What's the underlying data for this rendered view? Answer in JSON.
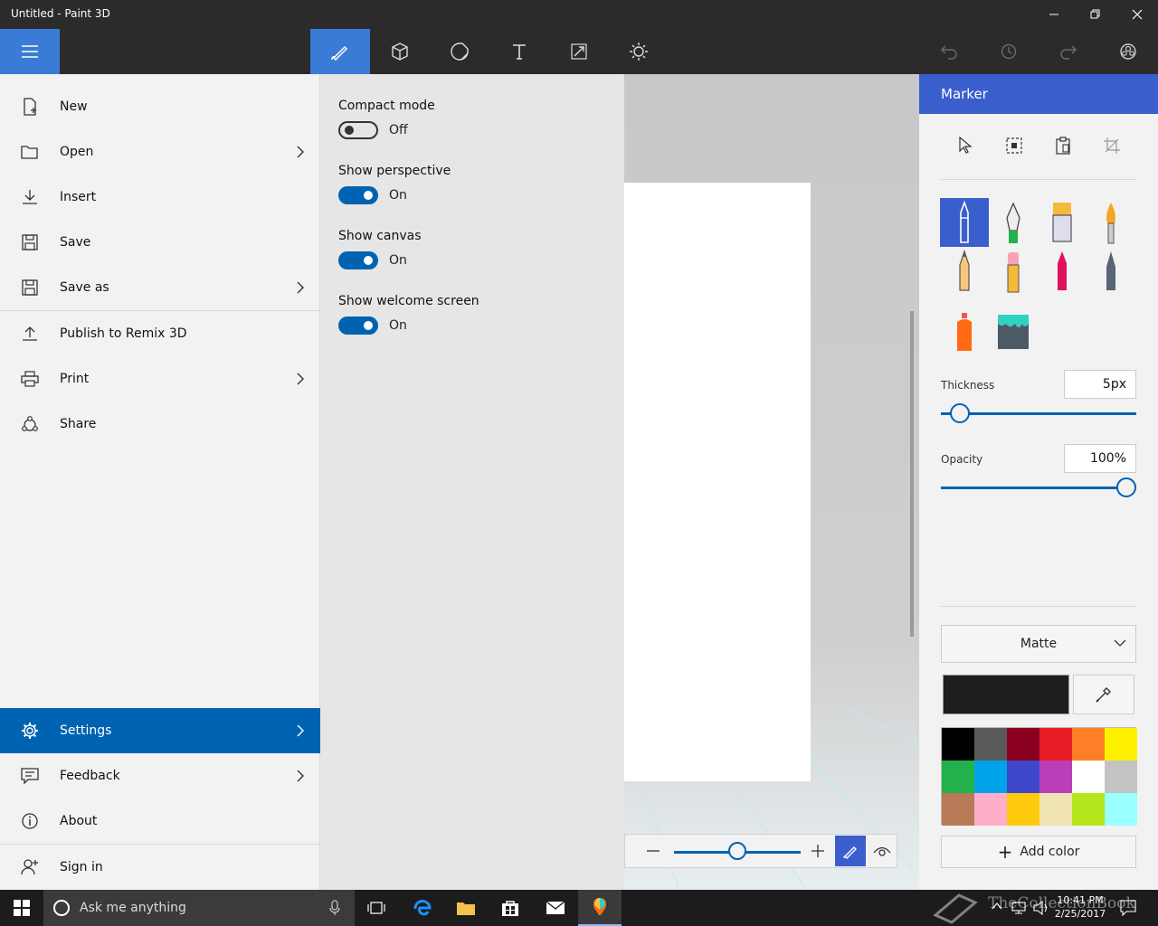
{
  "window": {
    "title": "Untitled - Paint 3D"
  },
  "menu": {
    "items": [
      {
        "label": "New",
        "icon": "new-file-icon"
      },
      {
        "label": "Open",
        "icon": "folder-icon"
      },
      {
        "label": "Insert",
        "icon": "insert-icon"
      },
      {
        "label": "Save",
        "icon": "save-icon"
      },
      {
        "label": "Save as",
        "icon": "save-as-icon"
      },
      {
        "label": "Publish to Remix 3D",
        "icon": "upload-icon"
      },
      {
        "label": "Print",
        "icon": "print-icon"
      },
      {
        "label": "Share",
        "icon": "share-icon"
      },
      {
        "label": "Settings",
        "icon": "gear-icon"
      },
      {
        "label": "Feedback",
        "icon": "feedback-icon"
      },
      {
        "label": "About",
        "icon": "info-icon"
      },
      {
        "label": "Sign in",
        "icon": "person-add-icon"
      }
    ]
  },
  "settings": {
    "compact_mode": {
      "label": "Compact mode",
      "state": "Off"
    },
    "show_perspective": {
      "label": "Show perspective",
      "state": "On"
    },
    "show_canvas": {
      "label": "Show canvas",
      "state": "On"
    },
    "show_welcome": {
      "label": "Show welcome screen",
      "state": "On"
    }
  },
  "panel": {
    "title": "Marker",
    "thickness_label": "Thickness",
    "thickness_value": "5px",
    "thickness_fraction": 0.05,
    "opacity_label": "Opacity",
    "opacity_value": "100%",
    "opacity_fraction": 1.0,
    "finish": "Matte",
    "add_color_label": "Add color",
    "current_color": "#1e1e1e",
    "palette": [
      "#000000",
      "#5a5a5a",
      "#8b0020",
      "#e81c24",
      "#ff7f27",
      "#fff200",
      "#22b14c",
      "#00a2e8",
      "#3f48cc",
      "#b83fb8",
      "#ffffff",
      "#c3c3c3",
      "#b97a57",
      "#ffaec9",
      "#ffc90e",
      "#efe4b0",
      "#b5e61d",
      "#99ffff"
    ]
  },
  "workspace": {
    "zoom_fraction": 0.5
  },
  "taskbar": {
    "search_placeholder": "Ask me anything",
    "time": "10:41 PM",
    "date": "2/25/2017",
    "watermark": "TheCollectionBook"
  }
}
